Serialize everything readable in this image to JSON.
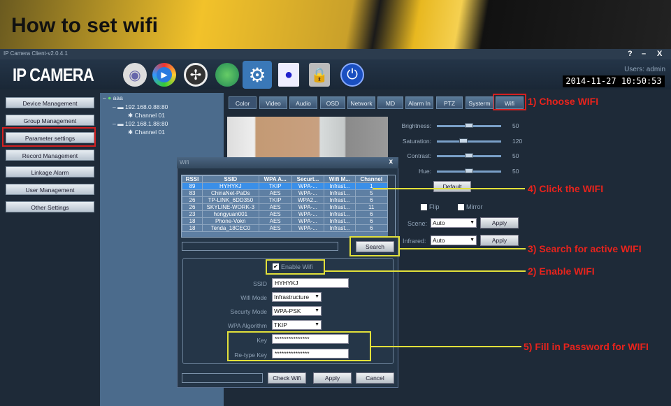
{
  "banner": {
    "title": "How to set wifi"
  },
  "window": {
    "title": "IP Camera Client-v2.0.4.1",
    "help": "?",
    "minimize": "–",
    "close": "X",
    "logo": "IP CAMERA",
    "user": "Users: admin",
    "clock": "2014-11-27 10:50:53"
  },
  "toolbar": {
    "icons": [
      "webcam-icon",
      "play-icon",
      "ptz-icon",
      "globe-icon",
      "settings-icon",
      "document-icon",
      "lock-icon",
      "power-icon"
    ]
  },
  "sidebar": {
    "items": [
      "Device Management",
      "Group Management",
      "Parameter settings",
      "Record Management",
      "Linkage Alarm",
      "User Management",
      "Other Settings"
    ]
  },
  "tree": {
    "root": "aaa",
    "devices": [
      {
        "ip": "192.168.0.88:80",
        "channel": "Channel 01"
      },
      {
        "ip": "192.168.1.88:80",
        "channel": "Channel 01"
      }
    ]
  },
  "tabs": [
    "Color",
    "Video",
    "Audio",
    "OSD",
    "Network",
    "MD",
    "Alarm In",
    "PTZ",
    "Systerm",
    "Wifi"
  ],
  "color": {
    "sliders": [
      {
        "label": "Brightness:",
        "value": 50
      },
      {
        "label": "Saturation:",
        "value": 120
      },
      {
        "label": "Contrast:",
        "value": 50
      },
      {
        "label": "Hue:",
        "value": 50
      }
    ],
    "default": "Default",
    "flip": "Flip",
    "mirror": "Mirror",
    "scene_label": "Scene:",
    "scene": "Auto",
    "infrared_label": "Infrared:",
    "infrared": "Auto",
    "apply": "Apply"
  },
  "wifi": {
    "title": "Wifi",
    "close": "x",
    "columns": [
      "RSSI",
      "SSID",
      "WPA A...",
      "Securt...",
      "Wifi M...",
      "Channel"
    ],
    "rows": [
      [
        "89",
        "HYHYKJ",
        "TKIP",
        "WPA-...",
        "Infrast...",
        "1"
      ],
      [
        "83",
        "ChinaNet-PaDs",
        "AES",
        "WPA-...",
        "Infrast...",
        "5"
      ],
      [
        "26",
        "TP-LINK_6DD350",
        "TKIP",
        "WPA2...",
        "Infrast...",
        "6"
      ],
      [
        "26",
        "SKYLINE-WORK-3",
        "AES",
        "WPA-...",
        "Infrast...",
        "11"
      ],
      [
        "23",
        "hongyuan001",
        "AES",
        "WPA-...",
        "Infrast...",
        "6"
      ],
      [
        "18",
        "Phone-Vokn",
        "AES",
        "WPA-...",
        "Infrast...",
        "6"
      ],
      [
        "18",
        "Tenda_18CEC0",
        "AES",
        "WPA-...",
        "Infrast...",
        "6"
      ]
    ],
    "search": "Search",
    "enable": "Enable Wifi",
    "enabled": true,
    "ssid_label": "SSID",
    "ssid": "HYHYKJ",
    "mode_label": "Wifi Mode",
    "mode": "Infrastructure",
    "sec_label": "Securty Mode",
    "sec": "WPA-PSK",
    "alg_label": "WPA Algorithm",
    "alg": "TKIP",
    "key_label": "Key",
    "key": "***************",
    "rekey_label": "Re-type Key",
    "rekey": "***************",
    "check": "Check Wifi",
    "apply": "Apply",
    "cancel": "Cancel"
  },
  "annotations": [
    "1) Choose WIFI",
    "4) Click the WIFI",
    "3) Search for active WIFI",
    "2) Enable WIFI",
    "5) Fill in Password for WIFI"
  ],
  "colors": {
    "annotation": "#e8231c",
    "highlight": "#e2e03a",
    "selected_row": "#3a8fe8"
  }
}
